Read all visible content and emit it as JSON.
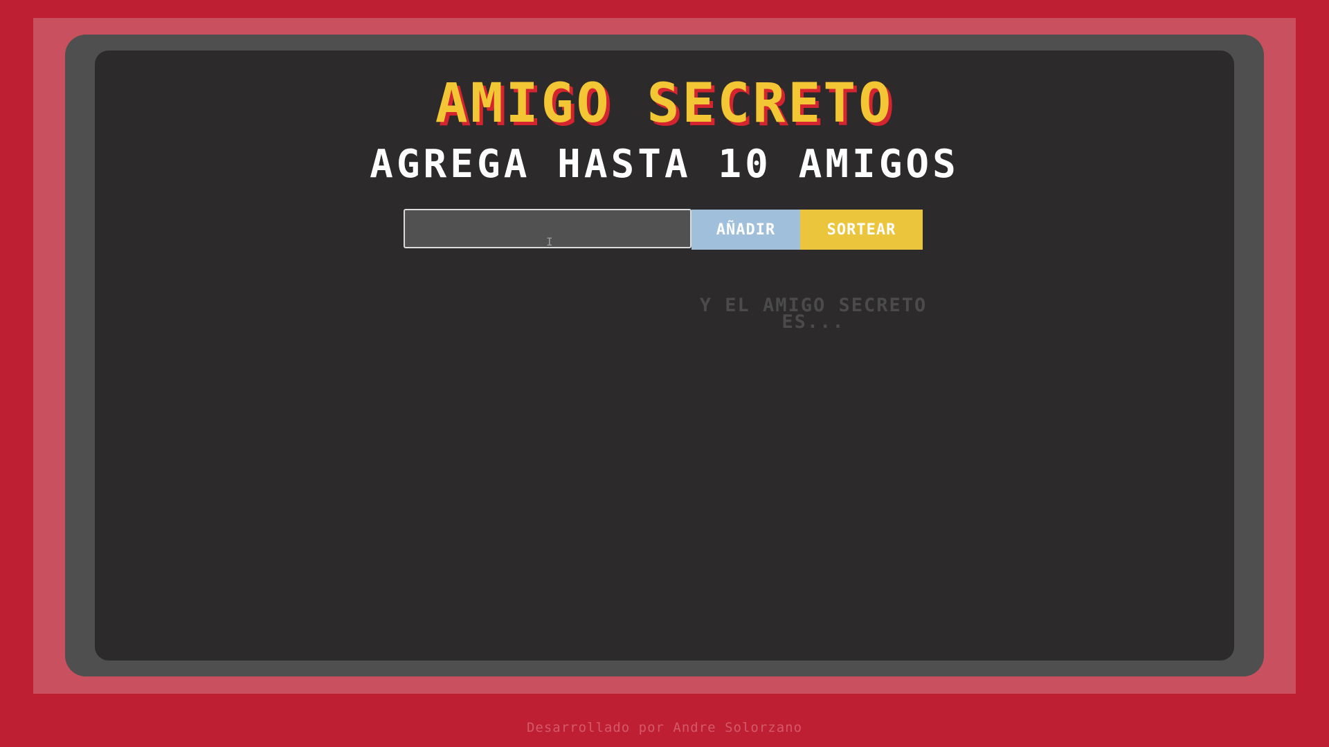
{
  "header": {
    "title": "AMIGO SECRETO",
    "subtitle": "AGREGA HASTA 10 AMIGOS"
  },
  "form": {
    "name_input_value": "",
    "add_button_label": "AÑADIR",
    "draw_button_label": "SORTEAR"
  },
  "friends": [],
  "result": {
    "text": "Y EL AMIGO SECRETO ES..."
  },
  "footer": {
    "credit": "Desarrollado por Andre Solorzano"
  },
  "colors": {
    "background": "#be1f33",
    "frame": "#c9515f",
    "bezel": "#4f4f4f",
    "screen": "#2c2a2a",
    "title": "#f2c635",
    "title_shadow": "#d3242f",
    "add_button": "#9fbfdb",
    "draw_button": "#ebc53b"
  }
}
